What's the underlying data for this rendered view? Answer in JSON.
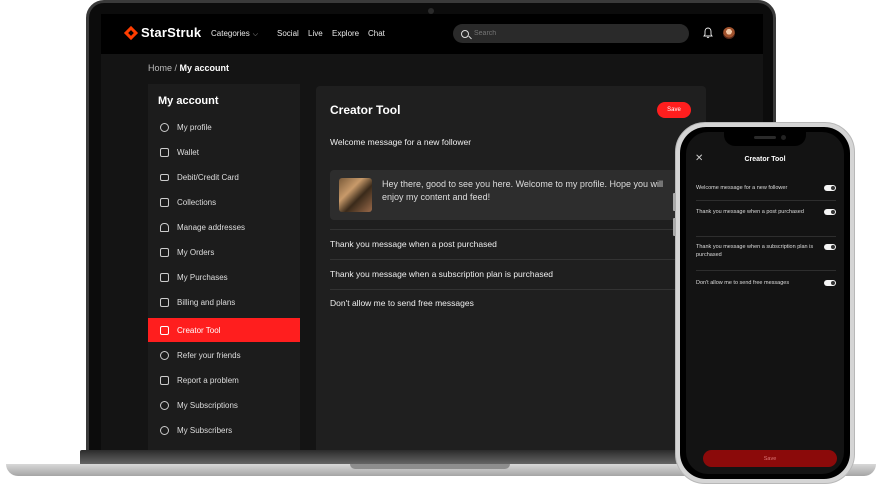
{
  "nav": {
    "brand": "StarStruk",
    "categories": "Categories",
    "social": "Social",
    "live": "Live",
    "explore": "Explore",
    "chat": "Chat",
    "search_placeholder": "Search"
  },
  "breadcrumb": {
    "home": "Home",
    "separator": " / ",
    "current": "My account"
  },
  "sidebar": {
    "title": "My account",
    "items": [
      {
        "label": "My profile",
        "icon": "user-circle-icon"
      },
      {
        "label": "Wallet",
        "icon": "wallet-icon"
      },
      {
        "label": "Debit/Credit Card",
        "icon": "credit-card-icon"
      },
      {
        "label": "Collections",
        "icon": "bookmark-icon"
      },
      {
        "label": "Manage addresses",
        "icon": "home-icon"
      },
      {
        "label": "My Orders",
        "icon": "orders-icon"
      },
      {
        "label": "My Purchases",
        "icon": "receipt-icon"
      },
      {
        "label": "Billing and plans",
        "icon": "document-icon"
      },
      {
        "label": "Creator Tool",
        "icon": "creator-tool-icon",
        "active": true
      },
      {
        "label": "Refer your friends",
        "icon": "users-icon"
      },
      {
        "label": "Report a problem",
        "icon": "report-icon"
      },
      {
        "label": "My Subscriptions",
        "icon": "subscription-icon"
      },
      {
        "label": "My Subscribers",
        "icon": "subscribers-icon"
      }
    ]
  },
  "creator_tool": {
    "title": "Creator Tool",
    "save_label": "Save",
    "welcome_label": "Welcome message for a new follower",
    "welcome_text": "Hey there, good to see you here. Welcome to my profile. Hope you will enjoy my content and feed!",
    "post_purchase_label": "Thank you message when a post purchased",
    "plan_purchase_label": "Thank you message when a subscription plan is purchased",
    "no_free_label": "Don't allow me to send free messages"
  },
  "phone": {
    "title": "Creator Tool",
    "close": "✕",
    "settings": [
      {
        "label": "Welcome message for a new follower",
        "enabled": true
      },
      {
        "label": "Thank you message when a post purchased",
        "enabled": true
      },
      {
        "label": "Thank you message when a subscription plan is purchased",
        "enabled": true
      },
      {
        "label": "Don't allow me to send free messages",
        "enabled": true
      }
    ],
    "save_label": "Save"
  },
  "colors": {
    "accent": "#ff1e1e",
    "background": "#141414",
    "card": "#1f1f1f"
  }
}
